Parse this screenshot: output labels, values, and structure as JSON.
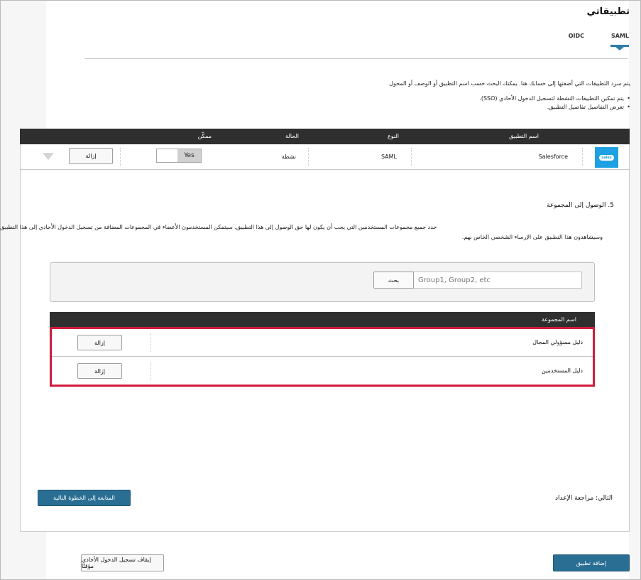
{
  "page": {
    "title": "تطبيقاتي",
    "tabs": [
      {
        "label": "SAML",
        "active": true
      },
      {
        "label": "OIDC",
        "active": false
      }
    ],
    "description": "يتم سرد التطبيقات التي أضفتها إلى حسابك هنا. يمكنك البحث حسب اسم التطبيق أو الوصف أو المحول",
    "bullets": [
      "يتم تمكين التطبيقات النشطة لتسجيل الدخول الأحادي (SSO).",
      "تعرض التفاصيل تفاصيل التطبيق."
    ]
  },
  "apps_table": {
    "columns": {
      "app_name": "اسم التطبيق",
      "type": "النوع",
      "status": "الحالة",
      "enabled": "ممكّن"
    },
    "rows": [
      {
        "logo": "salesforce",
        "name": "Salesforce",
        "type": "SAML",
        "status": "نشطة",
        "toggle": "Yes",
        "remove_label": "إزالة"
      }
    ]
  },
  "group_access": {
    "step_title": "5. الوصول إلى المجموعة",
    "desc_line1": "حدد جميع مجموعات المستخدمين التي يجب أن يكون لها حق الوصول إلى هذا التطبيق. سيتمكن المستخدمون الأعضاء في المجموعات المضافة من تسجيل الدخول الأحادي إلى هذا التطبيق",
    "desc_line2": "وسيشاهدون هذا التطبيق على الإرساء الشخصي الخاص بهم.",
    "search": {
      "placeholder": "Group1, Group2, etc",
      "button_label": "بحث"
    },
    "groups_header": "اسم المجموعة",
    "groups": [
      {
        "name": "دليل مسؤولي المجال",
        "remove_label": "إزالة"
      },
      {
        "name": "دليل المستخدمين",
        "remove_label": "إزالة"
      }
    ]
  },
  "footer": {
    "next_label": "التالي: مراجعة الإعداد",
    "continue_label": "المتابعة إلى الخطوة التالية",
    "add_app_label": "إضافة تطبيق",
    "stop_sso_label": "إيقاف تسجيل الدخول الأحادي مؤقتًا"
  },
  "colors": {
    "accent": "#2a6f93",
    "header_bg": "#2f2f2f",
    "highlight_border": "#d01a3a",
    "salesforce_blue": "#1ea1e2"
  }
}
